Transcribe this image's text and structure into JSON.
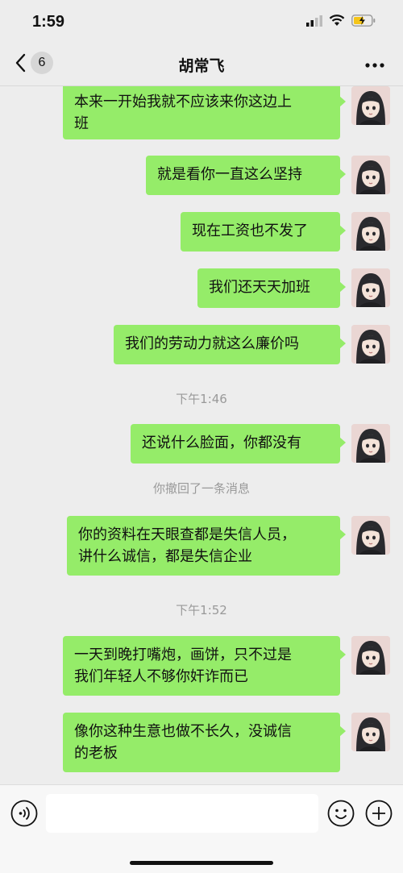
{
  "status": {
    "time": "1:59"
  },
  "nav": {
    "back_count": "6",
    "title": "胡常飞"
  },
  "messages": [
    {
      "line1": "本来一开始我就不应该来你这边上",
      "line2": "班"
    },
    {
      "line1": "就是看你一直这么坚持"
    },
    {
      "line1": "现在工资也不发了"
    },
    {
      "line1": "我们还天天加班"
    },
    {
      "line1": "我们的劳动力就这么廉价吗"
    },
    {
      "line1": "还说什么脸面，你都没有"
    },
    {
      "line1": "你的资料在天眼查都是失信人员，",
      "line2": "讲什么诚信，都是失信企业"
    },
    {
      "line1": "一天到晚打嘴炮，画饼，只不过是",
      "line2": "我们年轻人不够你奸诈而已"
    },
    {
      "line1": "像你这种生意也做不长久，没诚信",
      "line2": "的老板"
    }
  ],
  "timestamps": {
    "t1": "下午1:46",
    "t2": "下午1:52"
  },
  "system": {
    "recalled": "你撤回了一条消息"
  },
  "colors": {
    "bubble": "#95ec69",
    "background": "#ededed",
    "timestamp": "#999999"
  }
}
